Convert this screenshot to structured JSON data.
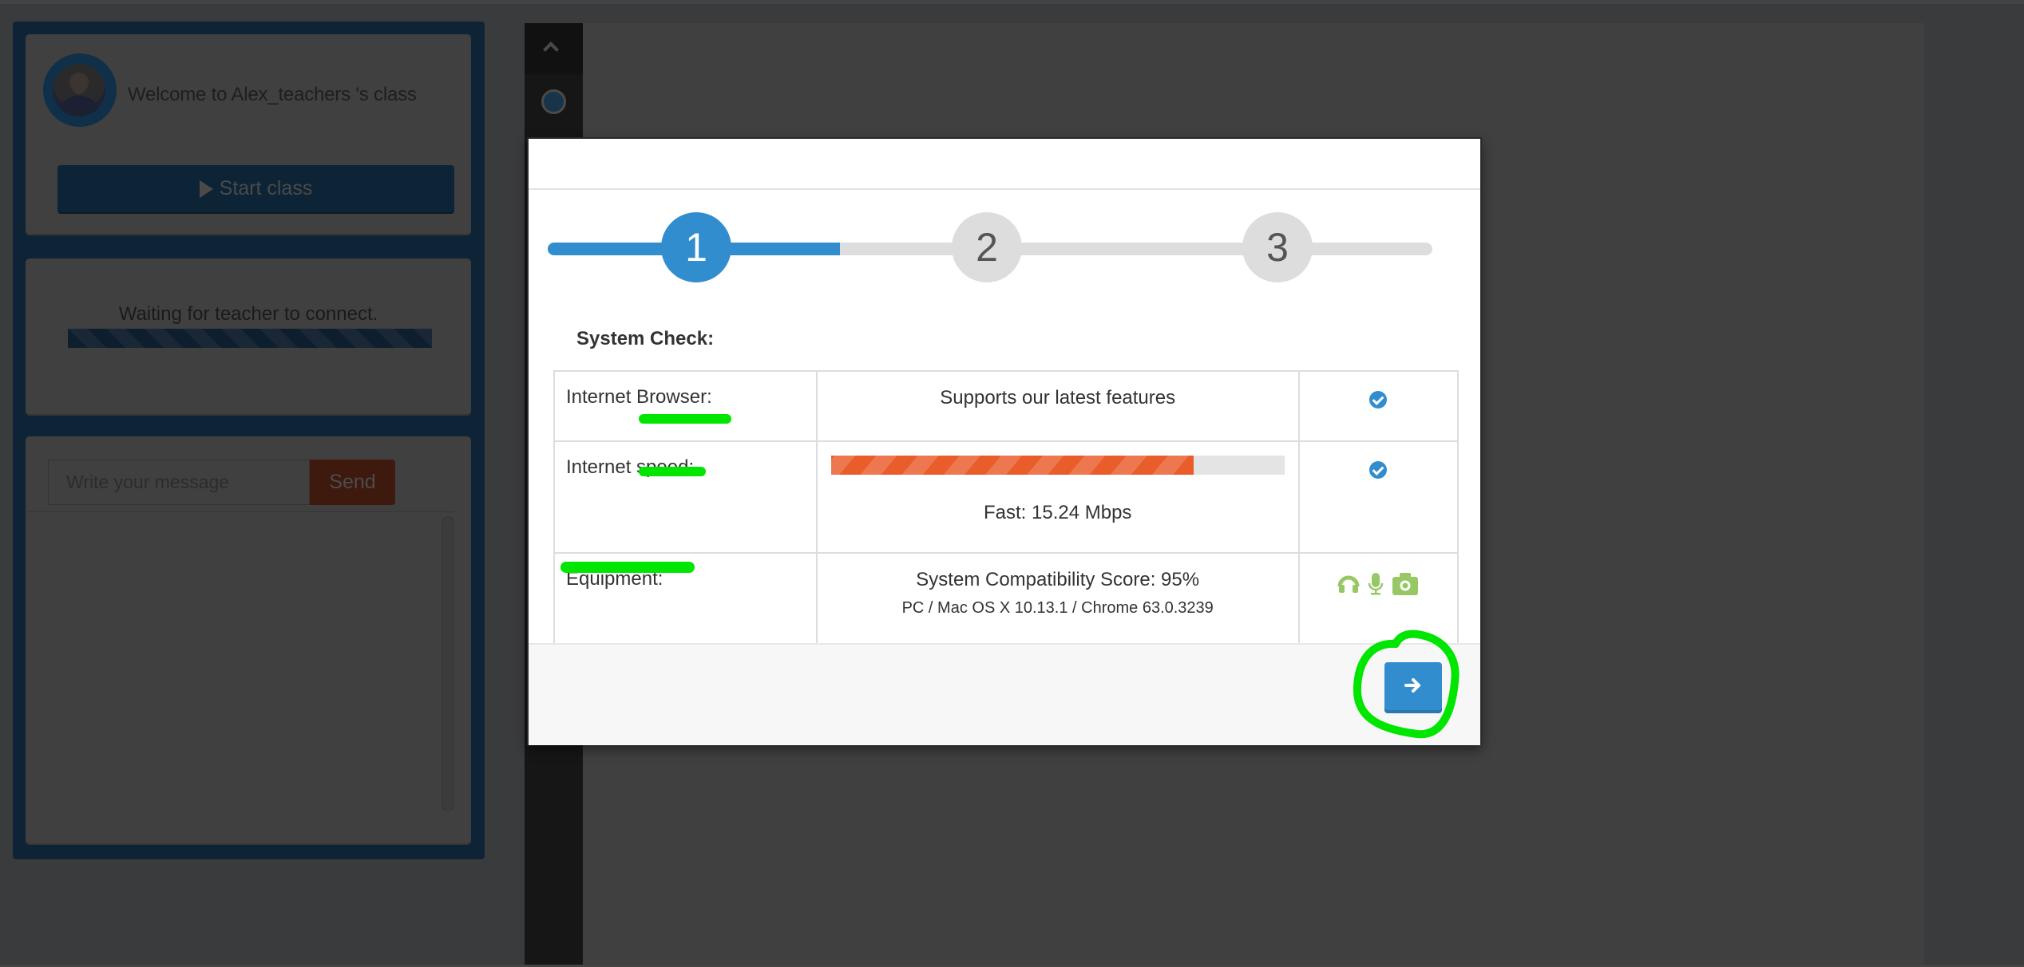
{
  "sidebar": {
    "welcome": "Welcome to Alex_teachers 's class",
    "avatar_alt": "teacher-avatar",
    "start_button": "Start class",
    "waiting_status": "Waiting for teacher to connect.",
    "chat": {
      "input_placeholder": "Write your message",
      "input_value": "",
      "send_button": "Send"
    }
  },
  "toolbar": {
    "icons": [
      "chevron-up-icon",
      "record-icon"
    ]
  },
  "modal": {
    "steps": [
      {
        "label": "1",
        "active": true
      },
      {
        "label": "2",
        "active": false
      },
      {
        "label": "3",
        "active": false
      }
    ],
    "step_progress_fraction": 0.33,
    "title": "System Check:",
    "rows": [
      {
        "label": "Internet Browser:",
        "value": "Supports our latest features",
        "status": "check-circle-icon"
      },
      {
        "label": "Internet speed:",
        "value": "Fast: 15.24 Mbps",
        "speed_bar_percent": 80,
        "status": "check-circle-icon"
      },
      {
        "label": "Equipment:",
        "value": "System Compatibility Score: 95%",
        "subvalue": "PC / Mac OS X 10.13.1 / Chrome 63.0.3239",
        "status_icons": [
          "headphones-icon",
          "microphone-icon",
          "camera-icon"
        ]
      }
    ],
    "next_button_icon": "arrow-right-icon"
  },
  "colors": {
    "primary": "#318dce",
    "speed_bar": "#e85d2a",
    "equipment_ok": "#97c865",
    "annotation": "#00e600",
    "send_button": "#3d1a0d"
  }
}
